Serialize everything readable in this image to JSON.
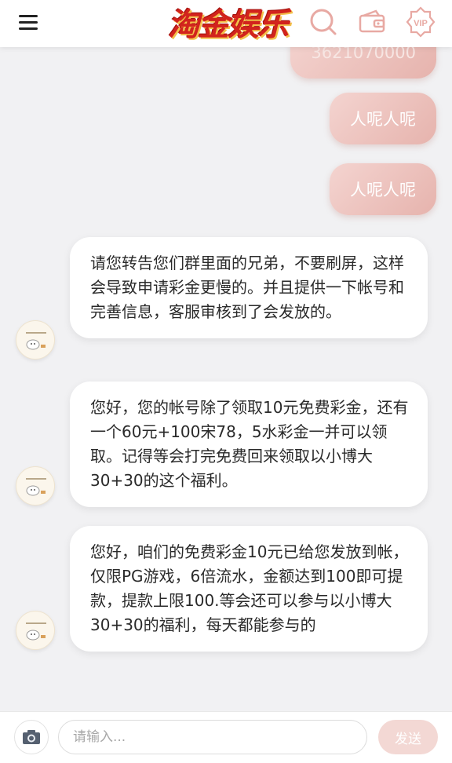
{
  "header": {
    "logo_text": "淘金娱乐",
    "icons": [
      "menu-icon",
      "search-icon",
      "wallet-icon",
      "vip-icon"
    ],
    "vip_label": "VIP"
  },
  "messages": {
    "outgoing": [
      {
        "text": "3621070000"
      },
      {
        "text": "人呢人呢"
      },
      {
        "text": "人呢人呢"
      }
    ],
    "incoming": [
      {
        "text": "请您转告您们群里面的兄弟，不要刷屏，这样会导致申请彩金更慢的。并且提供一下帐号和完善信息，客服审核到了会发放的。"
      },
      {
        "text": "您好，您的帐号除了领取10元免费彩金，还有一个60元+100宋78，5水彩金一并可以领取。记得等会打完免费回来领取以小博大30+30的这个福利。"
      },
      {
        "text": "您好，咱们的免费彩金10元已给您发放到帐，仅限PG游戏，6倍流水，金额达到100即可提款，提款上限100.等会还可以参与以小博大30+30的福利，每天都能参与的"
      }
    ]
  },
  "input_bar": {
    "placeholder": "请输入...",
    "send_label": "发送"
  },
  "colors": {
    "brand_red": "#d2231d",
    "outgoing_bubble": "#e6b3ad",
    "icon_pink": "#e8a9a3",
    "send_button": "#f3d8d4"
  }
}
